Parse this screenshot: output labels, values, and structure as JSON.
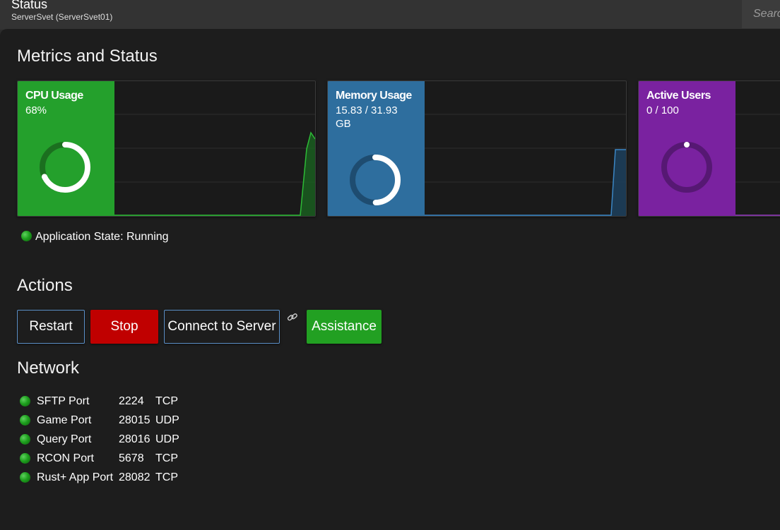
{
  "header": {
    "title": "Status",
    "subtitle": "ServerSvet (ServerSvet01)",
    "search_placeholder": "Search"
  },
  "sections": {
    "metrics": "Metrics and Status",
    "actions": "Actions",
    "network": "Network"
  },
  "metrics": {
    "cpu": {
      "label": "CPU Usage",
      "value": "68%",
      "fraction": 0.68,
      "color": "#24a02c"
    },
    "memory": {
      "label": "Memory Usage",
      "value": "15.83 / 31.93 GB",
      "fraction": 0.4958,
      "color": "#2e6e9e"
    },
    "users": {
      "label": "Active Users",
      "value": "0 / 100",
      "fraction": 0.0,
      "color": "#7a22a0"
    }
  },
  "app_state": {
    "text": "Application State: Running",
    "status_color": "#22a022"
  },
  "actions": {
    "restart": "Restart",
    "stop": "Stop",
    "connect": "Connect to Server",
    "assistance": "Assistance"
  },
  "network": {
    "ports": [
      {
        "name": "SFTP Port",
        "port": "2224",
        "protocol": "TCP"
      },
      {
        "name": "Game Port",
        "port": "28015",
        "protocol": "UDP"
      },
      {
        "name": "Query Port",
        "port": "28016",
        "protocol": "UDP"
      },
      {
        "name": "RCON Port",
        "port": "5678",
        "protocol": "TCP"
      },
      {
        "name": "Rust+ App Port",
        "port": "28082",
        "protocol": "TCP"
      }
    ]
  },
  "icons": {
    "link": "link-icon",
    "status": "status-led-icon"
  }
}
